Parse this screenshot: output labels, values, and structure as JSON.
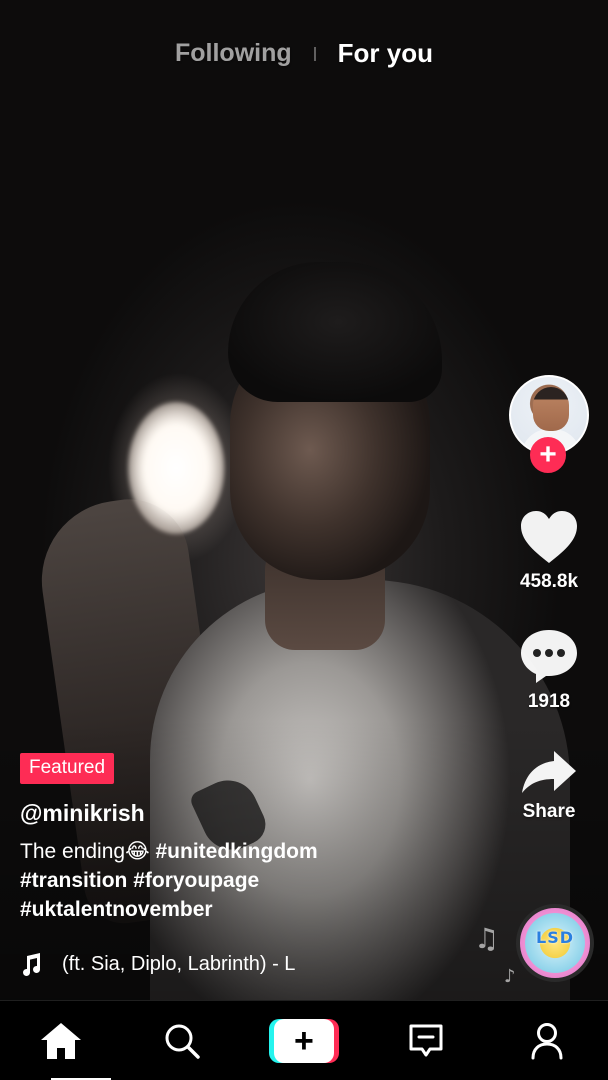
{
  "top_tabs": {
    "following": "Following",
    "for_you": "For you",
    "active": "For you"
  },
  "rail": {
    "likes": "458.8k",
    "comments": "1918",
    "share_label": "Share"
  },
  "post": {
    "badge": "Featured",
    "username": "@minikrish",
    "description_text": "The ending",
    "emoji": "😂",
    "hashtags": [
      "#unitedkingdom",
      "#transition",
      "#foryoupage",
      "#uktalentnovember"
    ],
    "music": "(ft. Sia, Diplo, Labrinth) - L"
  },
  "disc_label": "LSD",
  "colors": {
    "accent": "#fe2c55",
    "cyan": "#25f4ee",
    "nav_background": "#000000"
  },
  "nav": {
    "items": [
      "home-icon",
      "search-icon",
      "create-icon",
      "inbox-icon",
      "profile-icon"
    ],
    "active": "home-icon"
  }
}
